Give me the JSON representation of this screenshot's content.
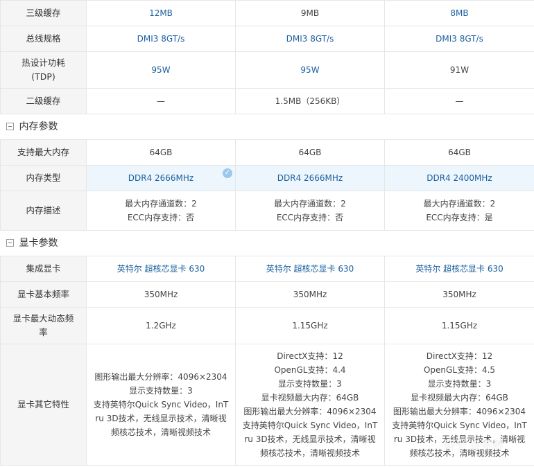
{
  "rows_top": [
    {
      "label": "三级缓存",
      "values": [
        "12MB",
        "9MB",
        "8MB"
      ]
    },
    {
      "label": "总线规格",
      "values": [
        "DMI3 8GT/s",
        "DMI3 8GT/s",
        "DMI3 8GT/s"
      ]
    },
    {
      "label_lines": [
        "热设计功耗",
        "(TDP)"
      ],
      "values": [
        "95W",
        "95W",
        "91W"
      ]
    },
    {
      "label": "二级缓存",
      "values": [
        "—",
        "1.5MB（256KB）",
        "—"
      ]
    }
  ],
  "section_memory": "内存参数",
  "rows_memory": [
    {
      "label": "支持最大内存",
      "values": [
        "64GB",
        "64GB",
        "64GB"
      ]
    },
    {
      "label": "内存类型",
      "values": [
        "DDR4 2666MHz",
        "DDR4 2666MHz",
        "DDR4 2400MHz"
      ]
    },
    {
      "label": "内存描述",
      "values": [
        [
          "最大内存通道数：2",
          "ECC内存支持：否"
        ],
        [
          "最大内存通道数：2",
          "ECC内存支持：否"
        ],
        [
          "最大内存通道数：2",
          "ECC内存支持：是"
        ]
      ]
    }
  ],
  "section_gpu": "显卡参数",
  "rows_gpu": [
    {
      "label": "集成显卡",
      "values": [
        "英特尔 超核芯显卡 630",
        "英特尔 超核芯显卡 630",
        "英特尔 超核芯显卡 630"
      ]
    },
    {
      "label": "显卡基本频率",
      "values": [
        "350MHz",
        "350MHz",
        "350MHz"
      ]
    },
    {
      "label_lines": [
        "显卡最大动态频",
        "率"
      ],
      "values": [
        "1.2GHz",
        "1.15GHz",
        "1.15GHz"
      ]
    },
    {
      "label": "显卡其它特性",
      "values": [
        [
          "图形输出最大分辨率：4096×2304",
          "显示支持数量：3",
          "支持英特尔Quick Sync Video，InT",
          "ru 3D技术，无线显示技术，清晰视",
          "频核芯技术，清晰视频技术"
        ],
        [
          "DirectX支持：12",
          "OpenGL支持：4.4",
          "显示支持数量：3",
          "显卡视频最大内存：64GB",
          "图形输出最大分辨率：4096×2304",
          "支持英特尔Quick Sync Video，InT",
          "ru 3D技术，无线显示技术，清晰视",
          "频核芯技术，清晰视频技术"
        ],
        [
          "DirectX支持：12",
          "OpenGL支持：4.5",
          "显示支持数量：3",
          "显卡视频最大内存：64GB",
          "图形输出最大分辨率：4096×2304",
          "支持英特尔Quick Sync Video，InT",
          "ru 3D技术，无线显示技术，清晰视",
          "频核芯技术，清晰视频技术"
        ]
      ]
    }
  ],
  "watermark": "知乎 @李啊"
}
